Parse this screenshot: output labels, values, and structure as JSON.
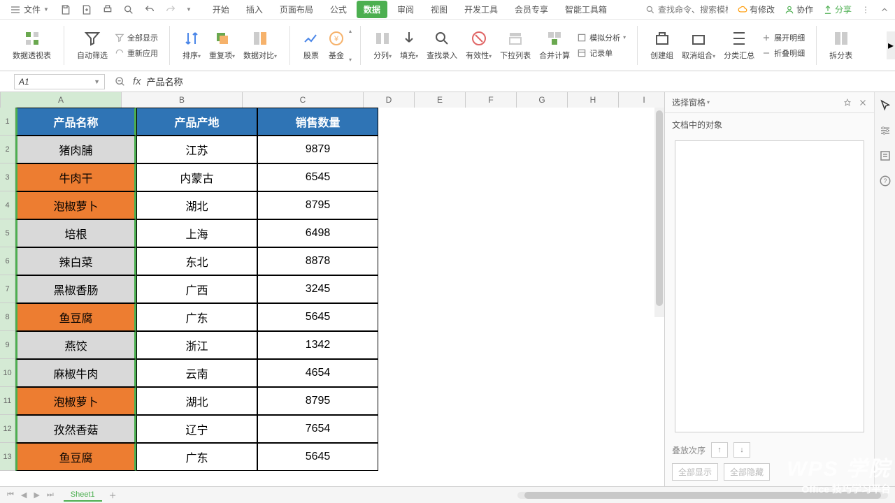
{
  "file_menu": {
    "label": "文件"
  },
  "tabs": [
    "开始",
    "插入",
    "页面布局",
    "公式",
    "数据",
    "审阅",
    "视图",
    "开发工具",
    "会员专享",
    "智能工具箱"
  ],
  "active_tab": "数据",
  "search": {
    "placeholder": "查找命令、搜索模板"
  },
  "top_right": {
    "update": "有修改",
    "coop": "协作",
    "share": "分享"
  },
  "ribbon": {
    "pivot": "数据透视表",
    "autofilter": "自动筛选",
    "show_all": "全部显示",
    "reapply": "重新应用",
    "sort": "排序",
    "dedup": "重复项",
    "compare": "数据对比",
    "stock": "股票",
    "fund": "基金",
    "split": "分列",
    "fill": "填充",
    "find": "查找录入",
    "valid": "有效性",
    "dropdown": "下拉列表",
    "merge": "合并计算",
    "sim": "模拟分析",
    "form": "记录单",
    "group": "创建组",
    "ungroup": "取消组合",
    "subtotal": "分类汇总",
    "expand": "展开明细",
    "collapse": "折叠明细",
    "split_table": "拆分表"
  },
  "name_box": "A1",
  "formula": "产品名称",
  "columns": [
    "A",
    "B",
    "C",
    "D",
    "E",
    "F",
    "G",
    "H",
    "I"
  ],
  "table": {
    "headers": [
      "产品名称",
      "产品产地",
      "销售数量"
    ],
    "rows": [
      {
        "name": "猪肉脯",
        "place": "江苏",
        "qty": "9879",
        "hl": false
      },
      {
        "name": "牛肉干",
        "place": "内蒙古",
        "qty": "6545",
        "hl": true
      },
      {
        "name": "泡椒萝卜",
        "place": "湖北",
        "qty": "8795",
        "hl": true
      },
      {
        "name": "培根",
        "place": "上海",
        "qty": "6498",
        "hl": false
      },
      {
        "name": "辣白菜",
        "place": "东北",
        "qty": "8878",
        "hl": false
      },
      {
        "name": "黑椒香肠",
        "place": "广西",
        "qty": "3245",
        "hl": false
      },
      {
        "name": "鱼豆腐",
        "place": "广东",
        "qty": "5645",
        "hl": true
      },
      {
        "name": "燕饺",
        "place": "浙江",
        "qty": "1342",
        "hl": false
      },
      {
        "name": "麻椒牛肉",
        "place": "云南",
        "qty": "4654",
        "hl": false
      },
      {
        "name": "泡椒萝卜",
        "place": "湖北",
        "qty": "8795",
        "hl": true
      },
      {
        "name": "孜然香菇",
        "place": "辽宁",
        "qty": "7654",
        "hl": false
      },
      {
        "name": "鱼豆腐",
        "place": "广东",
        "qty": "5645",
        "hl": true
      }
    ]
  },
  "panel": {
    "title": "选择窗格",
    "subtitle": "文档中的对象",
    "stack": "叠放次序",
    "show_all": "全部显示",
    "hide_all": "全部隐藏"
  },
  "sheet_tab": "Sheet1",
  "watermark": {
    "l1": "WPS 学院",
    "l2": "Office 技巧学习平台"
  }
}
